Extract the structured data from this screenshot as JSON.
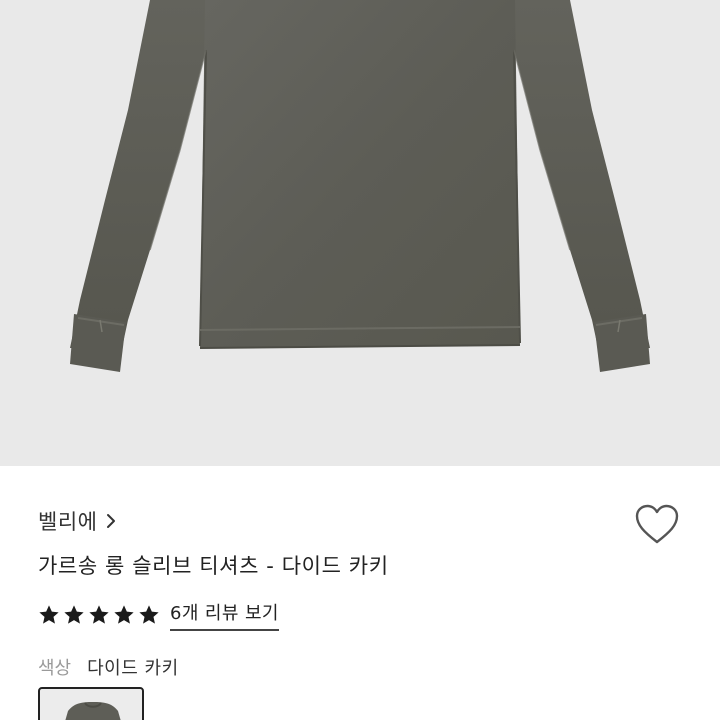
{
  "product": {
    "brand": "벨리에",
    "title": "가르송 롱 슬리브 티셔츠 - 다이드 카키",
    "rating": 5,
    "reviews_link": "6개 리뷰 보기",
    "color_label": "색상",
    "color_value": "다이드 카키"
  },
  "icons": {
    "brand_chevron": "chevron-right-icon",
    "wishlist": "heart-outline-icon",
    "star": "star-filled-icon"
  },
  "colors": {
    "background_image": "#e9e9e9",
    "garment": "#5e5e57",
    "text_primary": "#222222",
    "text_muted": "#9a9a9a"
  }
}
